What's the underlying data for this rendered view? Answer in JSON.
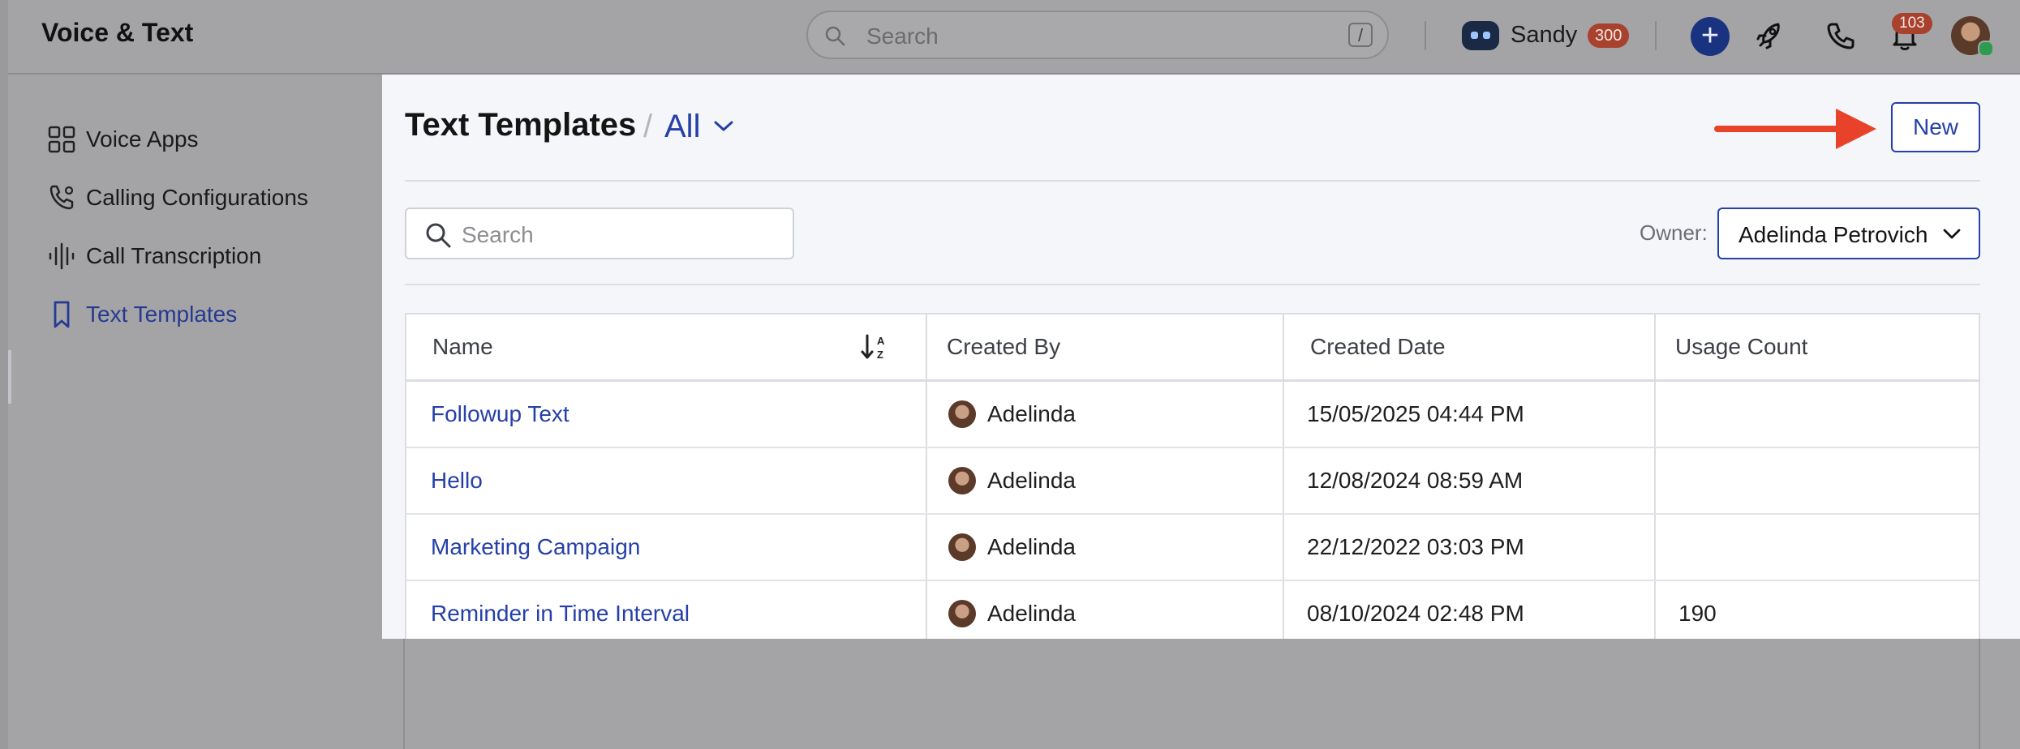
{
  "app": {
    "title": "Voice & Text"
  },
  "topbar": {
    "search_placeholder": "Search",
    "search_shortcut": "/",
    "user_name": "Sandy",
    "credits": "300",
    "notifications": "103"
  },
  "sidebar": {
    "items": [
      {
        "label": "Voice Apps",
        "icon": "grid-icon",
        "active": false
      },
      {
        "label": "Calling Configurations",
        "icon": "phone-settings-icon",
        "active": false
      },
      {
        "label": "Call Transcription",
        "icon": "waveform-icon",
        "active": false
      },
      {
        "label": "Text Templates",
        "icon": "bookmark-icon",
        "active": true
      }
    ]
  },
  "panel": {
    "title": "Text Templates",
    "separator": "/",
    "filter": "All",
    "new_label": "New",
    "search_placeholder": "Search",
    "owner_label": "Owner:",
    "owner_value": "Adelinda Petrovich"
  },
  "table": {
    "columns": [
      "Name",
      "Created By",
      "Created Date",
      "Usage Count"
    ],
    "rows": [
      {
        "name": "Followup Text",
        "created_by": "Adelinda",
        "created_date": "15/05/2025 04:44 PM",
        "usage": ""
      },
      {
        "name": "Hello",
        "created_by": "Adelinda",
        "created_date": "12/08/2024 08:59 AM",
        "usage": ""
      },
      {
        "name": "Marketing Campaign",
        "created_by": "Adelinda",
        "created_date": "22/12/2022 03:03 PM",
        "usage": ""
      },
      {
        "name": "Reminder in Time Interval",
        "created_by": "Adelinda",
        "created_date": "08/10/2024 02:48 PM",
        "usage": "190"
      }
    ]
  },
  "colors": {
    "accent": "#2540a8",
    "annotation_arrow": "#e8432a",
    "badge": "#a8412d",
    "overlay": "#a4a4a6"
  }
}
